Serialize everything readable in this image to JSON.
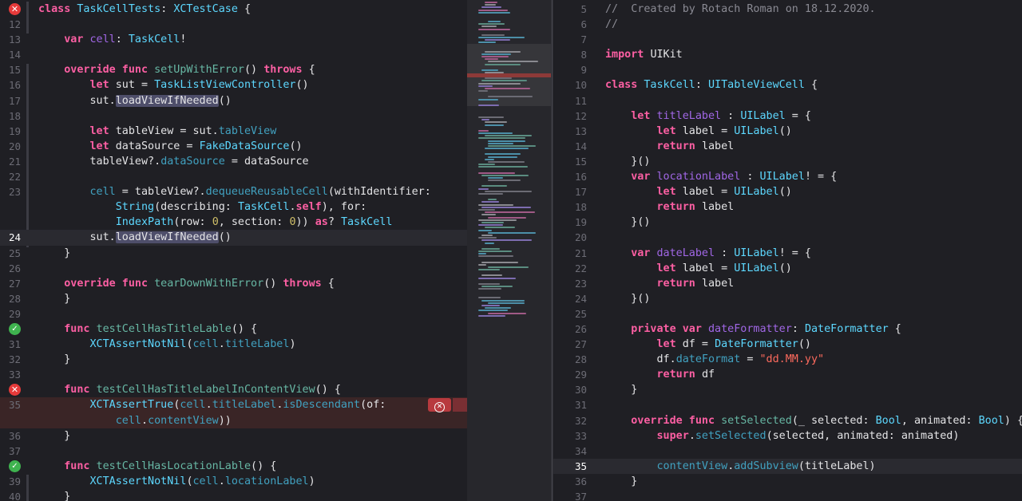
{
  "editor_left": {
    "rows": [
      {
        "n": "",
        "gutter": "error",
        "code": [
          [
            "kw",
            "class "
          ],
          [
            "ty",
            "TaskCellTests"
          ],
          [
            "p",
            ": "
          ],
          [
            "ty",
            "XCTestCase"
          ],
          [
            "p",
            " {"
          ]
        ]
      },
      {
        "n": "12",
        "code": []
      },
      {
        "n": "13",
        "code": [
          [
            "p",
            "    "
          ],
          [
            "kw",
            "var "
          ],
          [
            "pt",
            "cell"
          ],
          [
            "p",
            ": "
          ],
          [
            "ty",
            "TaskCell"
          ],
          [
            "p",
            "!"
          ]
        ]
      },
      {
        "n": "14",
        "code": []
      },
      {
        "n": "15",
        "code": [
          [
            "p",
            "    "
          ],
          [
            "kw",
            "override func "
          ],
          [
            "fn",
            "setUpWithError"
          ],
          [
            "p",
            "() "
          ],
          [
            "kw",
            "throws"
          ],
          [
            "p",
            " {"
          ]
        ]
      },
      {
        "n": "16",
        "code": [
          [
            "p",
            "        "
          ],
          [
            "kw",
            "let "
          ],
          [
            "p",
            "sut = "
          ],
          [
            "ty",
            "TaskListViewController"
          ],
          [
            "p",
            "()"
          ]
        ]
      },
      {
        "n": "17",
        "code": [
          [
            "p",
            "        sut."
          ],
          [
            "hl",
            "loadViewIfNeeded"
          ],
          [
            "p",
            "()"
          ]
        ]
      },
      {
        "n": "18",
        "code": []
      },
      {
        "n": "19",
        "code": [
          [
            "p",
            "        "
          ],
          [
            "kw",
            "let "
          ],
          [
            "p",
            "tableView = sut."
          ],
          [
            "pfn",
            "tableView"
          ]
        ]
      },
      {
        "n": "20",
        "code": [
          [
            "p",
            "        "
          ],
          [
            "kw",
            "let "
          ],
          [
            "p",
            "dataSource = "
          ],
          [
            "ty",
            "FakeDataSource"
          ],
          [
            "p",
            "()"
          ]
        ]
      },
      {
        "n": "21",
        "code": [
          [
            "p",
            "        tableView?."
          ],
          [
            "pfn",
            "dataSource"
          ],
          [
            "p",
            " = dataSource"
          ]
        ]
      },
      {
        "n": "22",
        "code": []
      },
      {
        "n": "23",
        "code": [
          [
            "p",
            "        "
          ],
          [
            "pfn",
            "cell"
          ],
          [
            "p",
            " = tableView?."
          ],
          [
            "pfn",
            "dequeueReusableCell"
          ],
          [
            "p",
            "(withIdentifier:"
          ]
        ]
      },
      {
        "n": "",
        "code": [
          [
            "p",
            "            "
          ],
          [
            "ty",
            "String"
          ],
          [
            "p",
            "(describing: "
          ],
          [
            "ty",
            "TaskCell"
          ],
          [
            "p",
            "."
          ],
          [
            "kw",
            "self"
          ],
          [
            "p",
            "), for:"
          ]
        ]
      },
      {
        "n": "",
        "code": [
          [
            "p",
            "            "
          ],
          [
            "ty",
            "IndexPath"
          ],
          [
            "p",
            "(row: "
          ],
          [
            "num",
            "0"
          ],
          [
            "p",
            ", section: "
          ],
          [
            "num",
            "0"
          ],
          [
            "p",
            ")) "
          ],
          [
            "kw",
            "as"
          ],
          [
            "p",
            "? "
          ],
          [
            "ty",
            "TaskCell"
          ]
        ]
      },
      {
        "n": "24",
        "active": true,
        "current": true,
        "code": [
          [
            "p",
            "        sut."
          ],
          [
            "hl",
            "loadViewIfNeeded"
          ],
          [
            "p",
            "()"
          ]
        ]
      },
      {
        "n": "25",
        "code": [
          [
            "p",
            "    }"
          ]
        ]
      },
      {
        "n": "26",
        "code": []
      },
      {
        "n": "27",
        "code": [
          [
            "p",
            "    "
          ],
          [
            "kw",
            "override func "
          ],
          [
            "fn",
            "tearDownWithError"
          ],
          [
            "p",
            "() "
          ],
          [
            "kw",
            "throws"
          ],
          [
            "p",
            " {"
          ]
        ]
      },
      {
        "n": "28",
        "code": [
          [
            "p",
            "    }"
          ]
        ]
      },
      {
        "n": "29",
        "code": []
      },
      {
        "n": "",
        "gutter": "ok",
        "code": [
          [
            "p",
            "    "
          ],
          [
            "kw",
            "func "
          ],
          [
            "fn",
            "testCellHasTitleLable"
          ],
          [
            "p",
            "() {"
          ]
        ]
      },
      {
        "n": "31",
        "code": [
          [
            "p",
            "        "
          ],
          [
            "ty",
            "XCTAssertNotNil"
          ],
          [
            "p",
            "("
          ],
          [
            "pfn",
            "cell"
          ],
          [
            "p",
            "."
          ],
          [
            "pfn",
            "titleLabel"
          ],
          [
            "p",
            ")"
          ]
        ]
      },
      {
        "n": "32",
        "code": [
          [
            "p",
            "    }"
          ]
        ]
      },
      {
        "n": "33",
        "code": []
      },
      {
        "n": "",
        "gutter": "error",
        "code": [
          [
            "p",
            "    "
          ],
          [
            "kw",
            "func "
          ],
          [
            "fn",
            "testCellHasTitleLabelInContentView"
          ],
          [
            "p",
            "() {"
          ]
        ]
      },
      {
        "n": "35",
        "error": true,
        "badge": true,
        "code": [
          [
            "p",
            "        "
          ],
          [
            "ty",
            "XCTAssertTrue"
          ],
          [
            "p",
            "("
          ],
          [
            "pfn",
            "cell"
          ],
          [
            "p",
            "."
          ],
          [
            "pfn",
            "titleLabel"
          ],
          [
            "p",
            "."
          ],
          [
            "pfn",
            "isDescendant"
          ],
          [
            "p",
            "(of:"
          ]
        ]
      },
      {
        "n": "",
        "error": true,
        "code": [
          [
            "p",
            "            "
          ],
          [
            "pfn",
            "cell"
          ],
          [
            "p",
            "."
          ],
          [
            "pfn",
            "contentView"
          ],
          [
            "p",
            "))"
          ]
        ]
      },
      {
        "n": "36",
        "code": [
          [
            "p",
            "    }"
          ]
        ]
      },
      {
        "n": "37",
        "code": []
      },
      {
        "n": "",
        "gutter": "ok",
        "code": [
          [
            "p",
            "    "
          ],
          [
            "kw",
            "func "
          ],
          [
            "fn",
            "testCellHasLocationLable"
          ],
          [
            "p",
            "() {"
          ]
        ]
      },
      {
        "n": "39",
        "code": [
          [
            "p",
            "        "
          ],
          [
            "ty",
            "XCTAssertNotNil"
          ],
          [
            "p",
            "("
          ],
          [
            "pfn",
            "cell"
          ],
          [
            "p",
            "."
          ],
          [
            "pfn",
            "locationLabel"
          ],
          [
            "p",
            ")"
          ]
        ]
      },
      {
        "n": "40",
        "code": [
          [
            "p",
            "    }"
          ]
        ]
      }
    ]
  },
  "editor_right": {
    "rows": [
      {
        "n": "5",
        "code": [
          [
            "cm",
            "//  Created by Rotach Roman on 18.12.2020."
          ]
        ]
      },
      {
        "n": "6",
        "code": [
          [
            "cm",
            "//"
          ]
        ]
      },
      {
        "n": "7",
        "code": []
      },
      {
        "n": "8",
        "code": [
          [
            "kw",
            "import "
          ],
          [
            "p",
            "UIKit"
          ]
        ]
      },
      {
        "n": "9",
        "code": []
      },
      {
        "n": "10",
        "code": [
          [
            "kw",
            "class "
          ],
          [
            "ty",
            "TaskCell"
          ],
          [
            "p",
            ": "
          ],
          [
            "ty",
            "UITableViewCell"
          ],
          [
            "p",
            " {"
          ]
        ]
      },
      {
        "n": "11",
        "code": []
      },
      {
        "n": "12",
        "code": [
          [
            "p",
            "    "
          ],
          [
            "kw",
            "let "
          ],
          [
            "pt",
            "titleLabel"
          ],
          [
            "p",
            " : "
          ],
          [
            "ty",
            "UILabel"
          ],
          [
            "p",
            " = {"
          ]
        ]
      },
      {
        "n": "13",
        "code": [
          [
            "p",
            "        "
          ],
          [
            "kw",
            "let "
          ],
          [
            "p",
            "label = "
          ],
          [
            "ty",
            "UILabel"
          ],
          [
            "p",
            "()"
          ]
        ]
      },
      {
        "n": "14",
        "code": [
          [
            "p",
            "        "
          ],
          [
            "kw",
            "return "
          ],
          [
            "p",
            "label"
          ]
        ]
      },
      {
        "n": "15",
        "code": [
          [
            "p",
            "    }()"
          ]
        ]
      },
      {
        "n": "16",
        "code": [
          [
            "p",
            "    "
          ],
          [
            "kw",
            "var "
          ],
          [
            "pt",
            "locationLabel"
          ],
          [
            "p",
            " : "
          ],
          [
            "ty",
            "UILabel"
          ],
          [
            "p",
            "! = {"
          ]
        ]
      },
      {
        "n": "17",
        "code": [
          [
            "p",
            "        "
          ],
          [
            "kw",
            "let "
          ],
          [
            "p",
            "label = "
          ],
          [
            "ty",
            "UILabel"
          ],
          [
            "p",
            "()"
          ]
        ]
      },
      {
        "n": "18",
        "code": [
          [
            "p",
            "        "
          ],
          [
            "kw",
            "return "
          ],
          [
            "p",
            "label"
          ]
        ]
      },
      {
        "n": "19",
        "code": [
          [
            "p",
            "    }()"
          ]
        ]
      },
      {
        "n": "20",
        "code": []
      },
      {
        "n": "21",
        "code": [
          [
            "p",
            "    "
          ],
          [
            "kw",
            "var "
          ],
          [
            "pt",
            "dateLabel"
          ],
          [
            "p",
            " : "
          ],
          [
            "ty",
            "UILabel"
          ],
          [
            "p",
            "! = {"
          ]
        ]
      },
      {
        "n": "22",
        "code": [
          [
            "p",
            "        "
          ],
          [
            "kw",
            "let "
          ],
          [
            "p",
            "label = "
          ],
          [
            "ty",
            "UILabel"
          ],
          [
            "p",
            "()"
          ]
        ]
      },
      {
        "n": "23",
        "code": [
          [
            "p",
            "        "
          ],
          [
            "kw",
            "return "
          ],
          [
            "p",
            "label"
          ]
        ]
      },
      {
        "n": "24",
        "code": [
          [
            "p",
            "    }()"
          ]
        ]
      },
      {
        "n": "25",
        "code": []
      },
      {
        "n": "26",
        "code": [
          [
            "p",
            "    "
          ],
          [
            "kw",
            "private var "
          ],
          [
            "pt",
            "dateFormatter"
          ],
          [
            "p",
            ": "
          ],
          [
            "ty",
            "DateFormatter"
          ],
          [
            "p",
            " {"
          ]
        ]
      },
      {
        "n": "27",
        "code": [
          [
            "p",
            "        "
          ],
          [
            "kw",
            "let "
          ],
          [
            "p",
            "df = "
          ],
          [
            "ty",
            "DateFormatter"
          ],
          [
            "p",
            "()"
          ]
        ]
      },
      {
        "n": "28",
        "code": [
          [
            "p",
            "        df."
          ],
          [
            "pfn",
            "dateFormat"
          ],
          [
            "p",
            " = "
          ],
          [
            "str",
            "\"dd.MM.yy\""
          ]
        ]
      },
      {
        "n": "29",
        "code": [
          [
            "p",
            "        "
          ],
          [
            "kw",
            "return "
          ],
          [
            "p",
            "df"
          ]
        ]
      },
      {
        "n": "30",
        "code": [
          [
            "p",
            "    }"
          ]
        ]
      },
      {
        "n": "31",
        "code": []
      },
      {
        "n": "32",
        "code": [
          [
            "p",
            "    "
          ],
          [
            "kw",
            "override func "
          ],
          [
            "fn",
            "setSelected"
          ],
          [
            "p",
            "(_ selected: "
          ],
          [
            "ty",
            "Bool"
          ],
          [
            "p",
            ", animated: "
          ],
          [
            "ty",
            "Bool"
          ],
          [
            "p",
            ") {"
          ]
        ]
      },
      {
        "n": "33",
        "code": [
          [
            "p",
            "        "
          ],
          [
            "kw",
            "super"
          ],
          [
            "p",
            "."
          ],
          [
            "pfn",
            "setSelected"
          ],
          [
            "p",
            "(selected, animated: animated)"
          ]
        ]
      },
      {
        "n": "34",
        "code": []
      },
      {
        "n": "35",
        "active": true,
        "current": true,
        "code": [
          [
            "p",
            "        "
          ],
          [
            "pfn",
            "contentView"
          ],
          [
            "p",
            "."
          ],
          [
            "pfn",
            "addSubview"
          ],
          [
            "p",
            "(titleLabel)"
          ]
        ]
      },
      {
        "n": "36",
        "code": [
          [
            "p",
            "    }"
          ]
        ]
      },
      {
        "n": "37",
        "code": []
      }
    ]
  },
  "minimap": {
    "colors": [
      "#6b6b74",
      "#a05a86",
      "#4c8fa8",
      "#5a8c80",
      "#7d6cb0",
      "#8a8a90"
    ]
  }
}
